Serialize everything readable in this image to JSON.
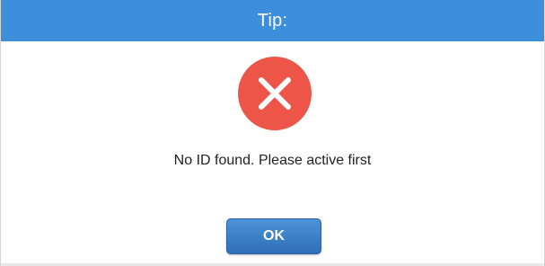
{
  "dialog": {
    "title": "Tip:",
    "message": "No ID found. Please active first",
    "ok_label": "OK",
    "icon": "error-x-icon"
  },
  "colors": {
    "titlebar": "#3d8fdb",
    "error_icon": "#ec5547",
    "button": "#3b7fc8"
  }
}
